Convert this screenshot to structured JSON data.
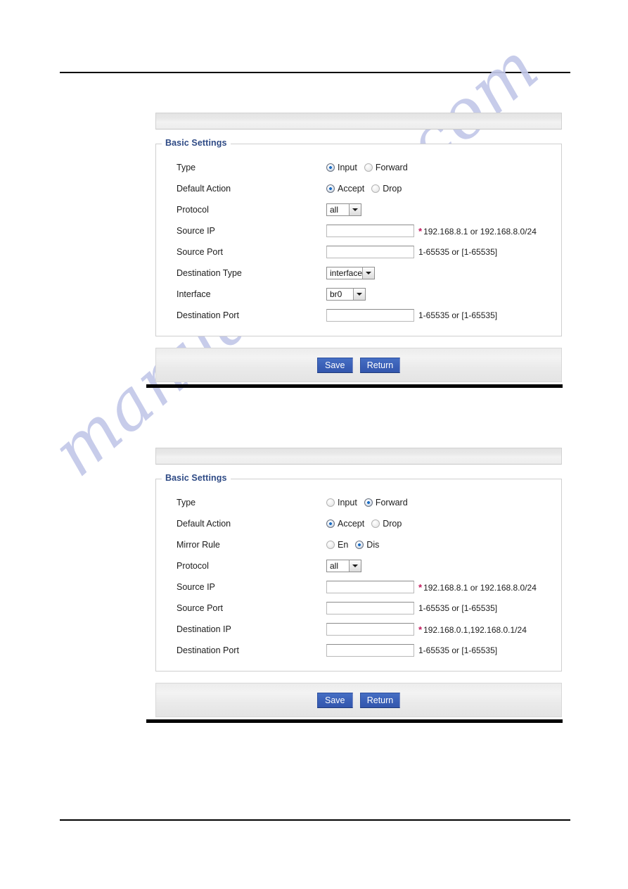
{
  "page": {
    "watermark_text": "manualshive.com",
    "watermark_color": "#c3c8e9",
    "rule_color": "#000000"
  },
  "common": {
    "legend": "Basic Settings",
    "save_label": "Save",
    "return_label": "Return",
    "port_hint": "1-65535 or [1-65535]",
    "required_marker": "*",
    "accent_color": "#2e4a85",
    "button_color": "#3b61b8",
    "required_color": "#c2185b"
  },
  "panels": [
    {
      "id": "input-rule-panel",
      "legend": "Basic Settings",
      "rows": [
        {
          "key": "type",
          "label": "Type",
          "control": "radio",
          "options": [
            {
              "label": "Input",
              "checked": true
            },
            {
              "label": "Forward",
              "checked": false
            }
          ]
        },
        {
          "key": "default-action",
          "label": "Default Action",
          "control": "radio",
          "options": [
            {
              "label": "Accept",
              "checked": true
            },
            {
              "label": "Drop",
              "checked": false
            }
          ]
        },
        {
          "key": "protocol",
          "label": "Protocol",
          "control": "select",
          "value": "all",
          "width_class": "w-protocol"
        },
        {
          "key": "source-ip",
          "label": "Source IP",
          "control": "text",
          "value": "",
          "required": true,
          "hint": "192.168.8.1 or  192.168.8.0/24"
        },
        {
          "key": "source-port",
          "label": "Source Port",
          "control": "text",
          "value": "",
          "required": false,
          "hint": "1-65535 or [1-65535]"
        },
        {
          "key": "destination-type",
          "label": "Destination Type",
          "control": "select",
          "value": "interface",
          "width_class": "w-desttype"
        },
        {
          "key": "interface",
          "label": "Interface",
          "control": "select",
          "value": "br0",
          "width_class": "w-interface"
        },
        {
          "key": "destination-port",
          "label": "Destination Port",
          "control": "text",
          "value": "",
          "required": false,
          "hint": "1-65535 or [1-65535]"
        }
      ]
    },
    {
      "id": "forward-rule-panel",
      "legend": "Basic Settings",
      "rows": [
        {
          "key": "type",
          "label": "Type",
          "control": "radio",
          "options": [
            {
              "label": "Input",
              "checked": false
            },
            {
              "label": "Forward",
              "checked": true
            }
          ]
        },
        {
          "key": "default-action",
          "label": "Default Action",
          "control": "radio",
          "options": [
            {
              "label": "Accept",
              "checked": true
            },
            {
              "label": "Drop",
              "checked": false
            }
          ]
        },
        {
          "key": "mirror-rule",
          "label": "Mirror Rule",
          "control": "radio",
          "options": [
            {
              "label": "En",
              "checked": false
            },
            {
              "label": "Dis",
              "checked": true
            }
          ]
        },
        {
          "key": "protocol",
          "label": "Protocol",
          "control": "select",
          "value": "all",
          "width_class": "w-protocol"
        },
        {
          "key": "source-ip",
          "label": "Source IP",
          "control": "text",
          "value": "",
          "required": true,
          "hint": "192.168.8.1 or 192.168.8.0/24"
        },
        {
          "key": "source-port",
          "label": "Source Port",
          "control": "text",
          "value": "",
          "required": false,
          "hint": "1-65535 or [1-65535]"
        },
        {
          "key": "destination-ip",
          "label": "Destination IP",
          "control": "text",
          "value": "",
          "required": true,
          "hint": "192.168.0.1,192.168.0.1/24"
        },
        {
          "key": "destination-port",
          "label": "Destination Port",
          "control": "text",
          "value": "",
          "required": false,
          "hint": "1-65535 or [1-65535]"
        }
      ]
    }
  ]
}
